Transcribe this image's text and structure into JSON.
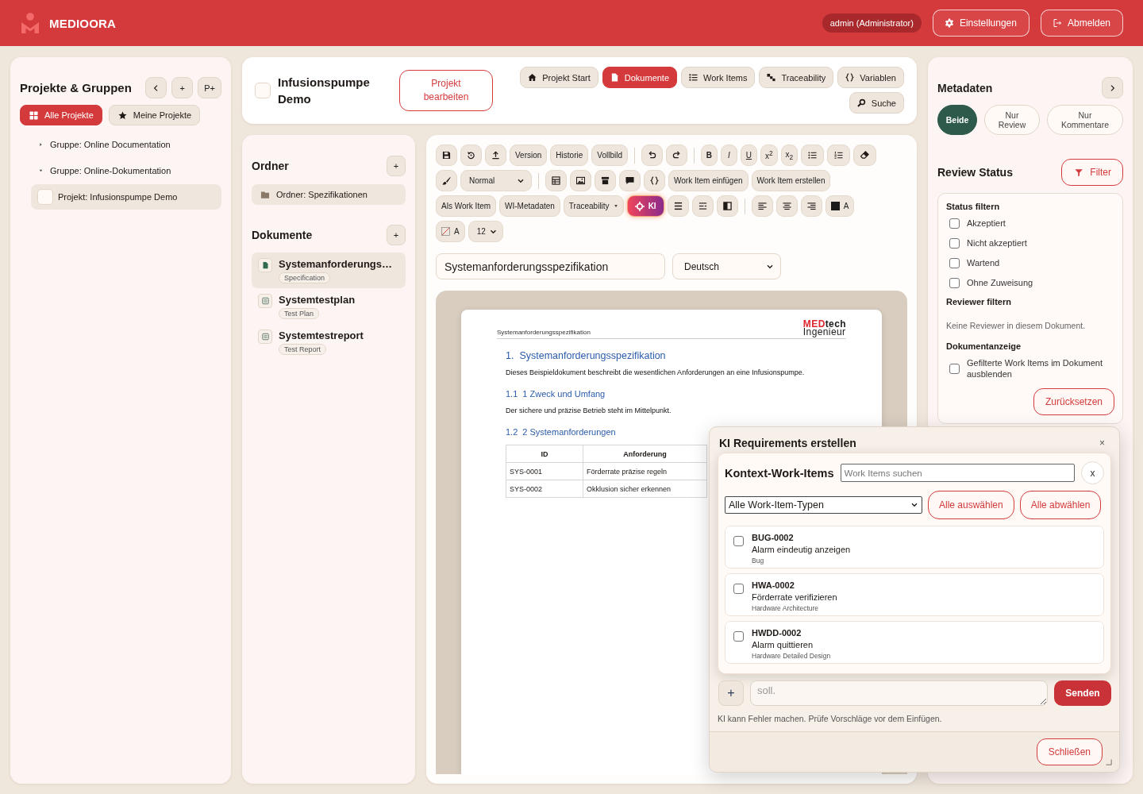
{
  "app": {
    "brand": "MEDIOORA",
    "user": "admin (Administrator)",
    "settings": "Einstellungen",
    "logout": "Abmelden"
  },
  "projects_panel": {
    "title": "Projekte & Gruppen",
    "actions": [
      "+",
      "P+"
    ],
    "filters": [
      {
        "label": "Alle Projekte",
        "kind": "all",
        "selected": true
      },
      {
        "label": "Meine Projekte",
        "kind": "favorites",
        "selected": false
      }
    ],
    "tree": [
      {
        "label": "Gruppe: Online Documentation",
        "expanded": false,
        "selected": false
      },
      {
        "label": "Gruppe: Online-Dokumentation",
        "expanded": true,
        "selected": false,
        "children": [
          {
            "label": "Projekt: Infusionspumpe Demo",
            "selected": true
          }
        ]
      }
    ]
  },
  "project": {
    "title": "Infusionspumpe Demo",
    "edit_button": "Projekt bearbeiten",
    "nav": [
      {
        "label": "Projekt Start",
        "kind": "home",
        "selected": false
      },
      {
        "label": "Dokumente",
        "kind": "documents",
        "selected": true
      },
      {
        "label": "Work Items",
        "kind": "list",
        "selected": false
      },
      {
        "label": "Traceability",
        "kind": "trace",
        "selected": false
      },
      {
        "label": "Variablen",
        "kind": "variables",
        "selected": false
      },
      {
        "label": "Suche",
        "kind": "search",
        "selected": false
      }
    ]
  },
  "folders_panel": {
    "folders_title": "Ordner",
    "add_folder": "+",
    "folders": [
      "Ordner: Spezifikationen"
    ],
    "documents_title": "Dokumente",
    "add_document": "+",
    "documents": [
      {
        "title": "Systemanforderungs…",
        "type": "Specification",
        "kind": "specification",
        "selected": true
      },
      {
        "title": "Systemtestplan",
        "type": "Test Plan",
        "kind": "test",
        "selected": false
      },
      {
        "title": "Systemtestreport",
        "type": "Test Report",
        "kind": "test",
        "selected": false
      }
    ]
  },
  "editor": {
    "toolbar": {
      "version": "Version",
      "history": "Historie",
      "fullscreen": "Vollbild",
      "bold": "B",
      "italic": "I",
      "underline": "U",
      "superscript": "x$^{2}$",
      "subscript": "x$_{2}$",
      "paragraph_style": "Normal",
      "insert_work_item": "Work Item einfügen",
      "create_work_item": "Work Item erstellen",
      "as_work_item": "Als Work Item",
      "wi_metadata": "WI-Metadaten",
      "traceability": "Traceability",
      "ai": "KI",
      "text_color": "A",
      "highlight_color": "A",
      "font_size": "12"
    },
    "document_title": "Systemanforderungsspezifikation",
    "language": "Deutsch",
    "page": {
      "running_header": "Systemanforderungsspezifikation",
      "logo": {
        "accent": "MED",
        "text": "tech",
        "subtitle": "Ingenieur"
      },
      "blocks": [
        {
          "kind": "h1",
          "number": "1.",
          "text": "Systemanforderungsspezifikation"
        },
        {
          "kind": "p",
          "text": "Dieses Beispieldokument beschreibt die wesentlichen Anforderungen an eine Infusionspumpe."
        },
        {
          "kind": "h2",
          "number": "1.1",
          "text": "1 Zweck und Umfang"
        },
        {
          "kind": "p",
          "text": "Der sichere und präzise Betrieb steht im Mittelpunkt."
        },
        {
          "kind": "h2",
          "number": "1.2",
          "text": "2 Systemanforderungen"
        },
        {
          "kind": "table",
          "columns": [
            "ID",
            "Anforderung"
          ],
          "rows": [
            [
              "SYS-0001",
              "Förderrate präzise regeln"
            ],
            [
              "SYS-0002",
              "Okklusion sicher erkennen"
            ]
          ]
        }
      ]
    }
  },
  "metadata_panel": {
    "title": "Metadaten",
    "views": [
      {
        "label": "Beide",
        "selected": true
      },
      {
        "label": "Nur Review",
        "selected": false
      },
      {
        "label": "Nur Kommentare",
        "selected": false
      }
    ],
    "review_title": "Review Status",
    "filter_button": "Filter",
    "status_heading": "Status filtern",
    "statuses": [
      {
        "label": "Akzeptiert",
        "checked": false
      },
      {
        "label": "Nicht akzeptiert",
        "checked": false
      },
      {
        "label": "Wartend",
        "checked": false
      },
      {
        "label": "Ohne Zuweisung",
        "checked": false
      }
    ],
    "reviewer_heading": "Reviewer filtern",
    "reviewer_empty": "Keine Reviewer in diesem Dokument.",
    "display_heading": "Dokumentanzeige",
    "hide_filtered": {
      "label": "Gefilterte Work Items im Dokument ausblenden",
      "checked": false
    },
    "reset": "Zurücksetzen"
  },
  "ai_dialog": {
    "title": "KI Requirements erstellen",
    "close": "×",
    "context_picker": {
      "title": "Kontext-Work-Items",
      "search": {
        "placeholder": "Work Items suchen"
      },
      "close": "x",
      "type_filter": "Alle Work-Item-Typen",
      "select_all": "Alle auswählen",
      "deselect_all": "Alle abwählen",
      "items": [
        {
          "id": "BUG-0002",
          "title": "Alarm eindeutig anzeigen",
          "type": "Bug",
          "checked": false
        },
        {
          "id": "HWA-0002",
          "title": "Förderrate verifizieren",
          "type": "Hardware Architecture",
          "checked": false
        },
        {
          "id": "HWDD-0002",
          "title": "Alarm quittieren",
          "type": "Hardware Detailed Design",
          "checked": false
        }
      ]
    },
    "attach": "+",
    "prompt": {
      "placeholder": "soll."
    },
    "send": "Senden",
    "disclaimer": "KI kann Fehler machen. Prüfe Vorschläge vor dem Einfügen.",
    "close_button": "Schließen"
  }
}
